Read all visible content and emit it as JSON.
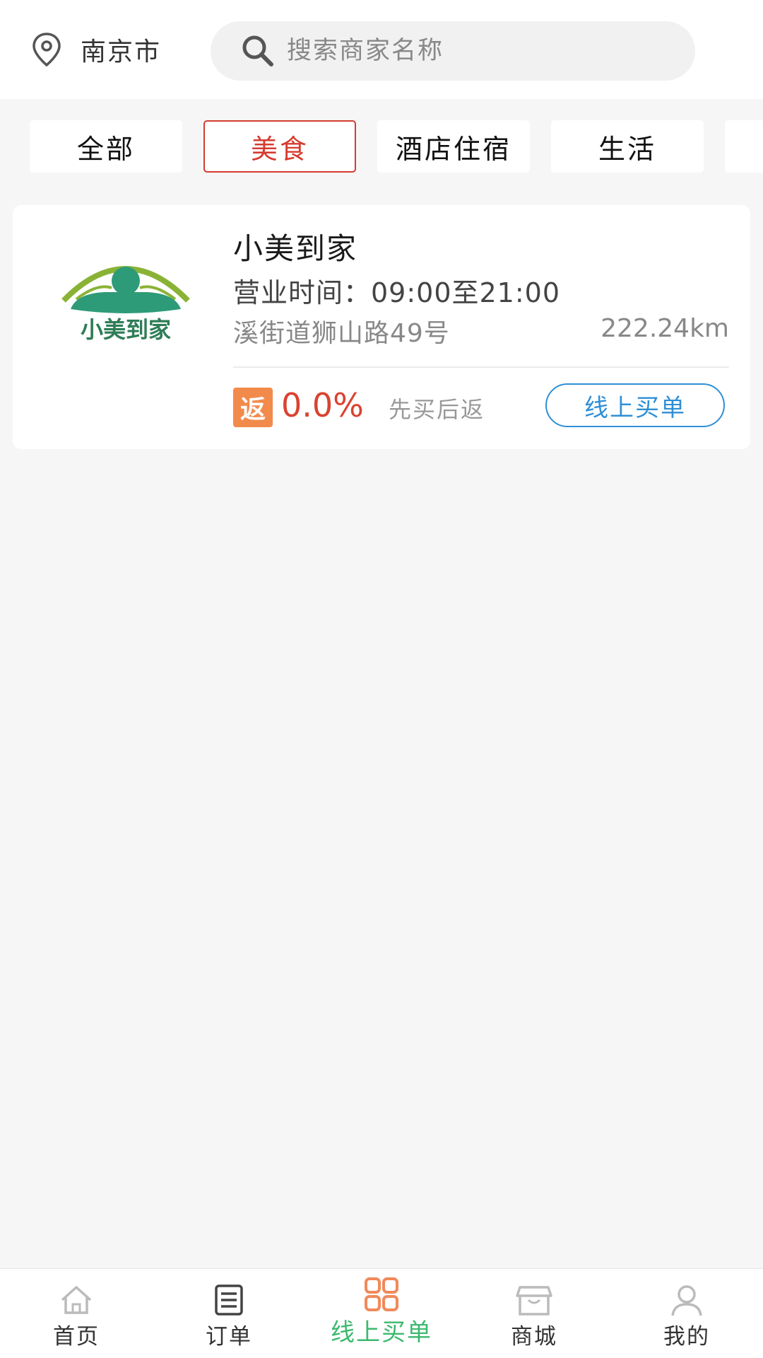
{
  "header": {
    "city": "南京市",
    "search_placeholder": "搜索商家名称"
  },
  "categories": [
    "全部",
    "美食",
    "酒店住宿",
    "生活"
  ],
  "active_category": "美食",
  "merchant": {
    "name": "小美到家",
    "logo_text": "小美到家",
    "hours": "营业时间：09:00至21:00",
    "address": "溪街道狮山路49号",
    "distance": "222.24km",
    "rebate_badge": "返",
    "rebate_rate": "0.0%",
    "rebate_note": "先买后返",
    "buy_button": "线上买单"
  },
  "tabbar": {
    "items": [
      {
        "label": "首页",
        "icon": "home-icon"
      },
      {
        "label": "订单",
        "icon": "order-list-icon"
      },
      {
        "label": "线上买单",
        "icon": "grid-icon"
      },
      {
        "label": "商城",
        "icon": "store-icon"
      },
      {
        "label": "我的",
        "icon": "user-icon"
      }
    ],
    "active": "线上买单"
  },
  "colors": {
    "accent_red": "#d43c2f",
    "button_blue": "#2e8fd6",
    "active_green": "#3bb96e",
    "badge_orange": "#f28a4c"
  }
}
